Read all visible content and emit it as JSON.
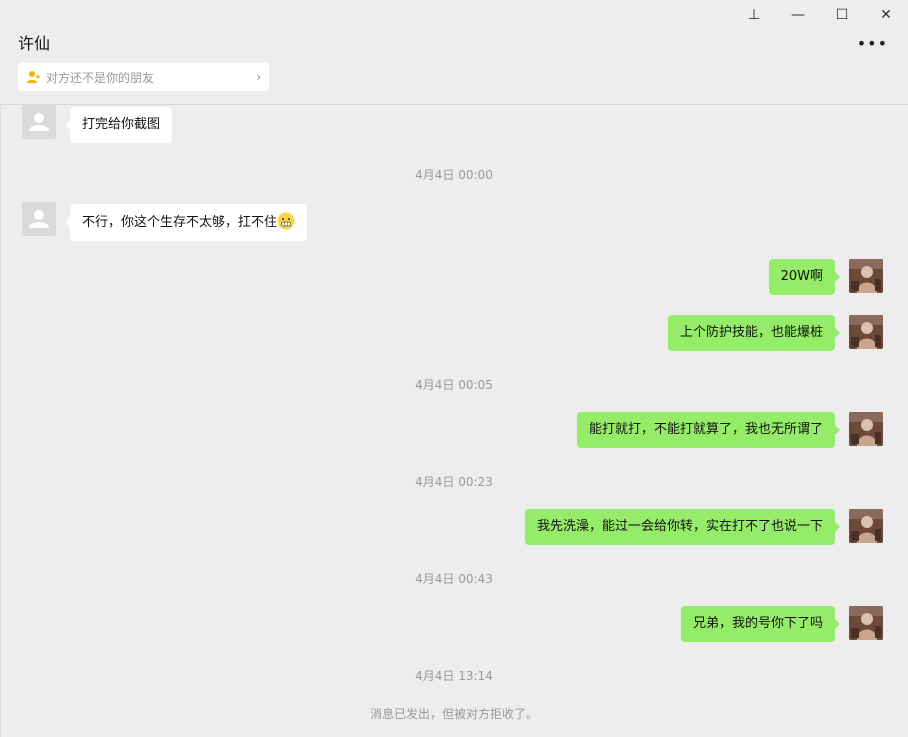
{
  "window": {
    "pin_icon": "⊥",
    "min_icon": "—",
    "max_icon": "☐",
    "close_icon": "✕"
  },
  "header": {
    "title": "许仙",
    "more_icon": "•••",
    "notice_text": "对方还不是你的朋友",
    "notice_chevron": "›"
  },
  "messages": [
    {
      "type": "in",
      "text": "打完给你截图"
    },
    {
      "type": "time",
      "text": "4月4日 00:00"
    },
    {
      "type": "in",
      "text": "不行，你这个生存不太够，扛不住"
    },
    {
      "type": "out",
      "text": "20W啊"
    },
    {
      "type": "out",
      "text": "上个防护技能，也能爆桩"
    },
    {
      "type": "time",
      "text": "4月4日 00:05"
    },
    {
      "type": "out",
      "text": "能打就打，不能打就算了，我也无所谓了"
    },
    {
      "type": "time",
      "text": "4月4日 00:23"
    },
    {
      "type": "out",
      "text": "我先洗澡，能过一会给你转，实在打不了也说一下"
    },
    {
      "type": "time",
      "text": "4月4日 00:43"
    },
    {
      "type": "out",
      "text": "兄弟，我的号你下了吗"
    },
    {
      "type": "time",
      "text": "4月4日 13:14"
    },
    {
      "type": "system",
      "text": "消息已发出，但被对方拒收了。"
    }
  ],
  "colors": {
    "background": "#ededed",
    "bubble_out": "#95ec69",
    "bubble_in": "#ffffff",
    "notice_icon": "#f5b400"
  }
}
